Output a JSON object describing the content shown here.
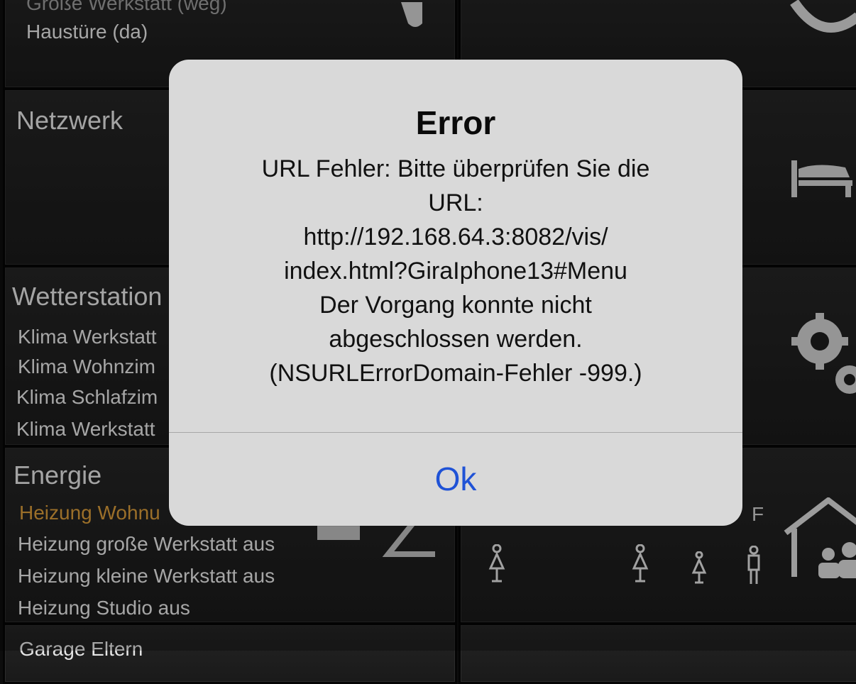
{
  "tiles": {
    "top_left": {
      "rows": [
        "Große Werkstatt (weg)",
        "Haustüre (da)"
      ]
    },
    "netzwerk": {
      "title": "Netzwerk"
    },
    "wetterstation": {
      "title": "Wetterstation",
      "rows": [
        "Klima Werkstatt",
        "Klima Wohnzim",
        "Klima Schlafzim",
        "Klima Werkstatt"
      ]
    },
    "energie": {
      "title": "Energie",
      "rows": [
        "Heizung Wohnu",
        "Heizung große Werkstatt aus",
        "Heizung kleine Werkstatt aus",
        "Heizung Studio aus"
      ]
    },
    "garage": {
      "title": "Garage Eltern"
    },
    "family": {
      "letter": "F"
    }
  },
  "icons": {
    "top_right": "clock-icon",
    "bed": "bed-icon",
    "gears": "gears-icon",
    "house": "house-family-icon",
    "persons": [
      "person-female-icon",
      "person-female-icon",
      "person-female-icon",
      "person-male-icon"
    ]
  },
  "alert": {
    "title": "Error",
    "message_lines": [
      "URL Fehler: Bitte überprüfen Sie die",
      "URL:",
      "http://192.168.64.3:8082/vis/",
      "index.html?GiraIphone13#Menu",
      "Der Vorgang konnte nicht",
      "abgeschlossen werden.",
      "(NSURLErrorDomain-Fehler -999.)"
    ],
    "button_label": "Ok",
    "button_color": "#1f52d6"
  }
}
